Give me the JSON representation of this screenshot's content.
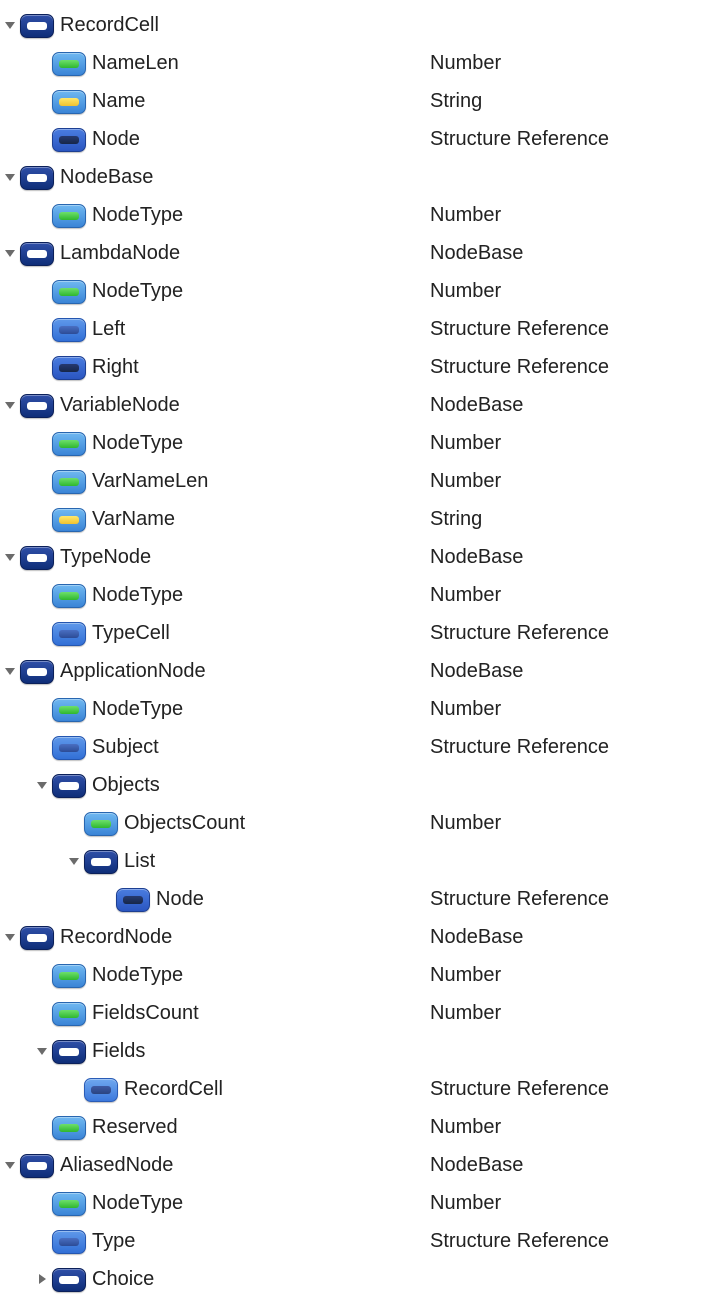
{
  "icon_kinds": {
    "container": "container",
    "number": "number",
    "string": "string",
    "refdark": "refdark",
    "refmid": "refmid",
    "reflight": "reflight"
  },
  "tree": [
    {
      "indent": 0,
      "arrow": "down",
      "icon": "container",
      "name": "RecordCell",
      "type": ""
    },
    {
      "indent": 1,
      "arrow": "",
      "icon": "number",
      "name": "NameLen",
      "type": "Number"
    },
    {
      "indent": 1,
      "arrow": "",
      "icon": "string",
      "name": "Name",
      "type": "String"
    },
    {
      "indent": 1,
      "arrow": "",
      "icon": "refdark",
      "name": "Node",
      "type": "Structure Reference"
    },
    {
      "indent": 0,
      "arrow": "down",
      "icon": "container",
      "name": "NodeBase",
      "type": ""
    },
    {
      "indent": 1,
      "arrow": "",
      "icon": "number",
      "name": "NodeType",
      "type": "Number"
    },
    {
      "indent": 0,
      "arrow": "down",
      "icon": "container",
      "name": "LambdaNode",
      "type": "NodeBase"
    },
    {
      "indent": 1,
      "arrow": "",
      "icon": "number",
      "name": "NodeType",
      "type": "Number"
    },
    {
      "indent": 1,
      "arrow": "",
      "icon": "refmid",
      "name": "Left",
      "type": "Structure Reference"
    },
    {
      "indent": 1,
      "arrow": "",
      "icon": "refdark",
      "name": "Right",
      "type": "Structure Reference"
    },
    {
      "indent": 0,
      "arrow": "down",
      "icon": "container",
      "name": "VariableNode",
      "type": "NodeBase"
    },
    {
      "indent": 1,
      "arrow": "",
      "icon": "number",
      "name": "NodeType",
      "type": "Number"
    },
    {
      "indent": 1,
      "arrow": "",
      "icon": "number",
      "name": "VarNameLen",
      "type": "Number"
    },
    {
      "indent": 1,
      "arrow": "",
      "icon": "string",
      "name": "VarName",
      "type": "String"
    },
    {
      "indent": 0,
      "arrow": "down",
      "icon": "container",
      "name": "TypeNode",
      "type": "NodeBase"
    },
    {
      "indent": 1,
      "arrow": "",
      "icon": "number",
      "name": "NodeType",
      "type": "Number"
    },
    {
      "indent": 1,
      "arrow": "",
      "icon": "refmid",
      "name": "TypeCell",
      "type": "Structure Reference"
    },
    {
      "indent": 0,
      "arrow": "down",
      "icon": "container",
      "name": "ApplicationNode",
      "type": "NodeBase"
    },
    {
      "indent": 1,
      "arrow": "",
      "icon": "number",
      "name": "NodeType",
      "type": "Number"
    },
    {
      "indent": 1,
      "arrow": "",
      "icon": "refmid",
      "name": "Subject",
      "type": "Structure Reference"
    },
    {
      "indent": 1,
      "arrow": "down",
      "icon": "container",
      "name": "Objects",
      "type": ""
    },
    {
      "indent": 2,
      "arrow": "",
      "icon": "number",
      "name": "ObjectsCount",
      "type": "Number"
    },
    {
      "indent": 2,
      "arrow": "down",
      "icon": "container",
      "name": "List",
      "type": ""
    },
    {
      "indent": 3,
      "arrow": "",
      "icon": "refdark",
      "name": "Node",
      "type": "Structure Reference"
    },
    {
      "indent": 0,
      "arrow": "down",
      "icon": "container",
      "name": "RecordNode",
      "type": "NodeBase"
    },
    {
      "indent": 1,
      "arrow": "",
      "icon": "number",
      "name": "NodeType",
      "type": "Number"
    },
    {
      "indent": 1,
      "arrow": "",
      "icon": "number",
      "name": "FieldsCount",
      "type": "Number"
    },
    {
      "indent": 1,
      "arrow": "down",
      "icon": "container",
      "name": "Fields",
      "type": ""
    },
    {
      "indent": 2,
      "arrow": "",
      "icon": "reflight",
      "name": "RecordCell",
      "type": "Structure Reference"
    },
    {
      "indent": 1,
      "arrow": "",
      "icon": "number",
      "name": "Reserved",
      "type": "Number"
    },
    {
      "indent": 0,
      "arrow": "down",
      "icon": "container",
      "name": "AliasedNode",
      "type": "NodeBase"
    },
    {
      "indent": 1,
      "arrow": "",
      "icon": "number",
      "name": "NodeType",
      "type": "Number"
    },
    {
      "indent": 1,
      "arrow": "",
      "icon": "refmid",
      "name": "Type",
      "type": "Structure Reference"
    },
    {
      "indent": 1,
      "arrow": "right",
      "icon": "container",
      "name": "Choice",
      "type": ""
    }
  ]
}
